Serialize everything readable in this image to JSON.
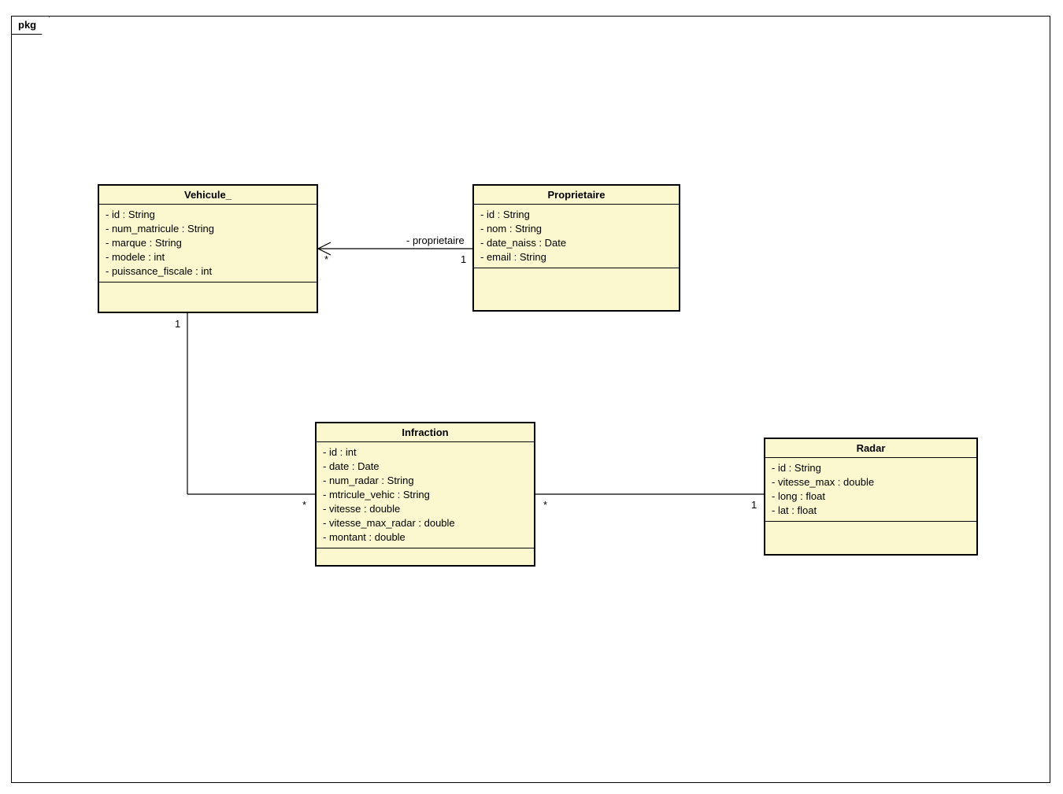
{
  "package": {
    "name": "pkg"
  },
  "classes": {
    "vehicule": {
      "name": "Vehicule_",
      "attributes": [
        "- id : String",
        "- num_matricule : String",
        "- marque : String",
        "- modele : int",
        "- puissance_fiscale : int"
      ]
    },
    "proprietaire": {
      "name": "Proprietaire",
      "attributes": [
        "- id : String",
        "- nom : String",
        "- date_naiss : Date",
        "- email : String"
      ]
    },
    "infraction": {
      "name": "Infraction",
      "attributes": [
        "- id : int",
        "- date : Date",
        "- num_radar : String",
        "- mtricule_vehic : String",
        "- vitesse : double",
        "- vitesse_max_radar : double",
        "- montant : double"
      ]
    },
    "radar": {
      "name": "Radar",
      "attributes": [
        "- id : String",
        "- vitesse_max : double",
        "- long : float",
        "- lat : float"
      ]
    }
  },
  "associations": {
    "proprietaire_vehicule": {
      "label": "- proprietaire",
      "end_vehicule_mult": "*",
      "end_proprietaire_mult": "1"
    },
    "vehicule_infraction": {
      "end_vehicule_mult": "1",
      "end_infraction_mult": "*"
    },
    "infraction_radar": {
      "end_infraction_mult": "*",
      "end_radar_mult": "1"
    }
  }
}
